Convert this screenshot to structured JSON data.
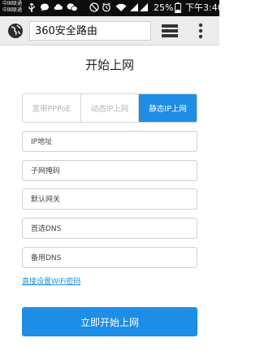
{
  "status_bar": {
    "carrier_1": "中国联通",
    "carrier_2": "中国联通",
    "battery_percent": "25%",
    "time": "下午3:40",
    "icons": [
      "usb-icon",
      "chat-bubble-icon",
      "cloud-icon",
      "wechat-icon",
      "dnd-icon",
      "alarm-icon",
      "wifi-icon",
      "signal-icon",
      "battery-icon"
    ]
  },
  "browser": {
    "url": "360安全路由",
    "left_icon": "globe-icon",
    "tabs_icon": "tabs-icon",
    "menu_icon": "overflow-menu-icon"
  },
  "page": {
    "title": "开始上网",
    "mode_tabs": [
      {
        "label": "宽带PPPoE",
        "active": false
      },
      {
        "label": "动态IP上网",
        "active": false
      },
      {
        "label": "静态IP上网",
        "active": true
      }
    ],
    "fields": {
      "ip_address": {
        "placeholder": "IP地址",
        "value": ""
      },
      "subnet_mask": {
        "placeholder": "子网掩码",
        "value": ""
      },
      "default_gateway": {
        "placeholder": "默认网关",
        "value": ""
      },
      "primary_dns": {
        "placeholder": "首选DNS",
        "value": ""
      },
      "secondary_dns": {
        "placeholder": "备用DNS",
        "value": ""
      }
    },
    "wifi_link": "直接设置WiFi密码",
    "submit_label": "立即开始上网",
    "accent_color": "#1e8de6"
  }
}
